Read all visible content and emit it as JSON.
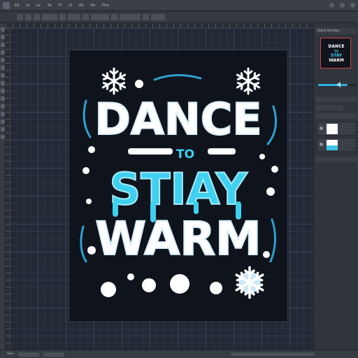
{
  "menubar": {
    "items": [
      "Ps",
      "Ed",
      "Ia",
      "La",
      "Se",
      "Fl",
      "Vi",
      "Wi",
      "He"
    ],
    "title": "Pinx"
  },
  "optionbar": {
    "items": [
      "",
      "",
      "",
      "",
      "",
      "",
      "",
      "",
      "",
      "",
      "",
      ""
    ]
  },
  "panel": {
    "title": "Daick Divrdan",
    "thumb_lines": [
      "DANCE",
      "TO",
      "STAY",
      "WARM"
    ],
    "slider_value": 0.78
  },
  "artwork": {
    "line1": "DANCE",
    "line2": "TO",
    "line3": "STIAY",
    "line4": "WARM"
  },
  "statusbar": {
    "label": "Stav"
  },
  "colors": {
    "accent": "#3fd0ef",
    "artboard": "#0f141c",
    "canvas": "#232a36",
    "selection": "#d04545"
  },
  "icons": [
    "snowflake-icon",
    "eye-icon",
    "slider-knob-icon"
  ]
}
